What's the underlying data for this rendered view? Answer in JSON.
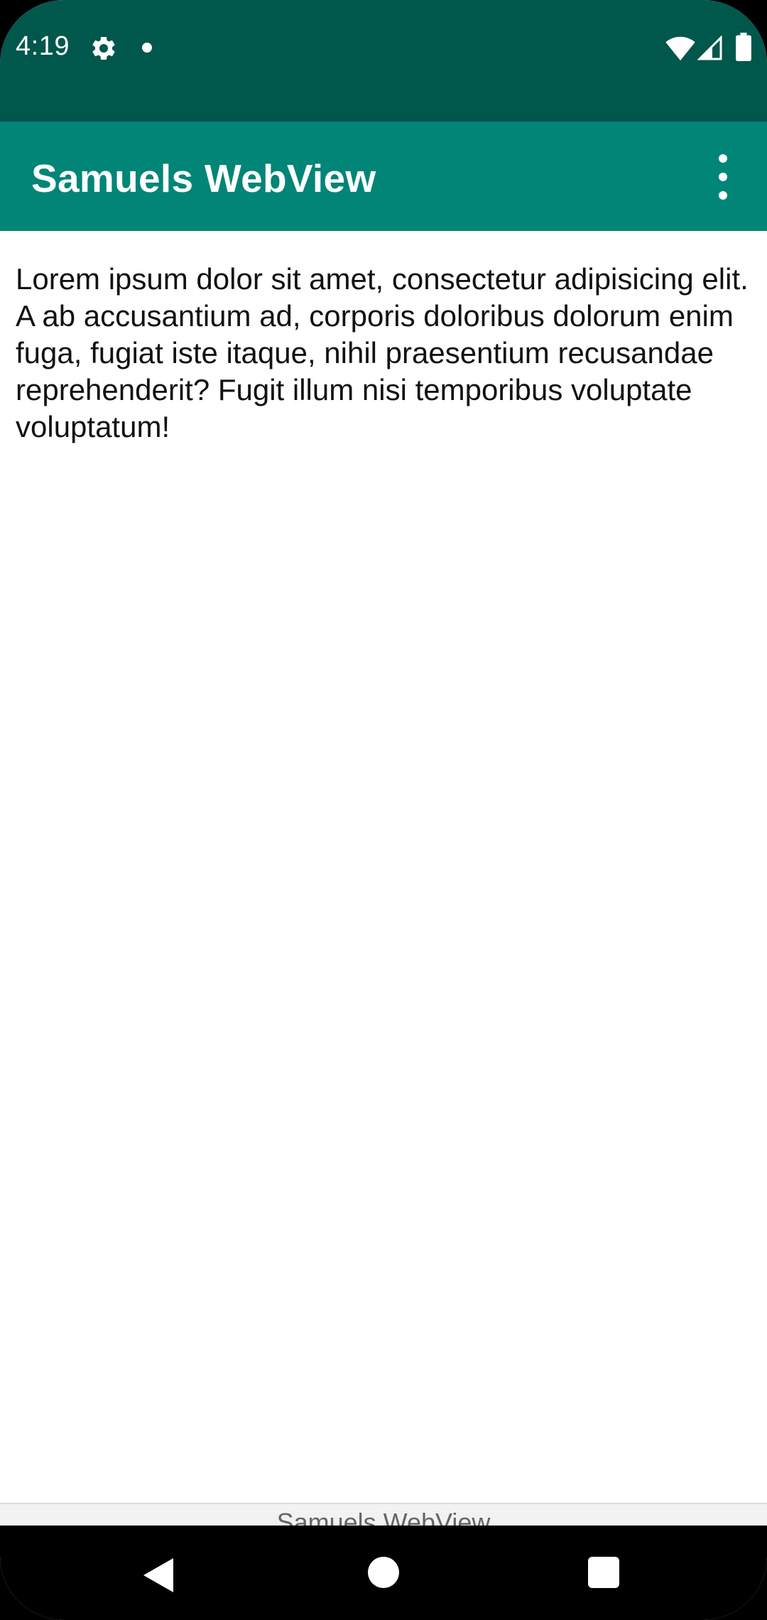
{
  "status_bar": {
    "time": "4:19",
    "background_color": "#00574b",
    "icons": [
      "gear-icon",
      "notification-dot-icon",
      "wifi-icon",
      "signal-icon",
      "battery-icon"
    ]
  },
  "app_bar": {
    "title": "Samuels WebView",
    "background_color": "#008577",
    "overflow_icon": "more-vert-icon"
  },
  "webview": {
    "paragraph": "Lorem ipsum dolor sit amet, consectetur adipisicing elit. A ab accusantium ad, corporis doloribus dolorum enim fuga, fugiat iste itaque, nihil praesentium recusandae reprehenderit? Fugit illum nisi temporibus voluptate voluptatum!"
  },
  "bottom_label": {
    "text": "Samuels WebView"
  },
  "nav_bar": {
    "icons": [
      "back-icon",
      "home-icon",
      "recents-icon"
    ]
  }
}
